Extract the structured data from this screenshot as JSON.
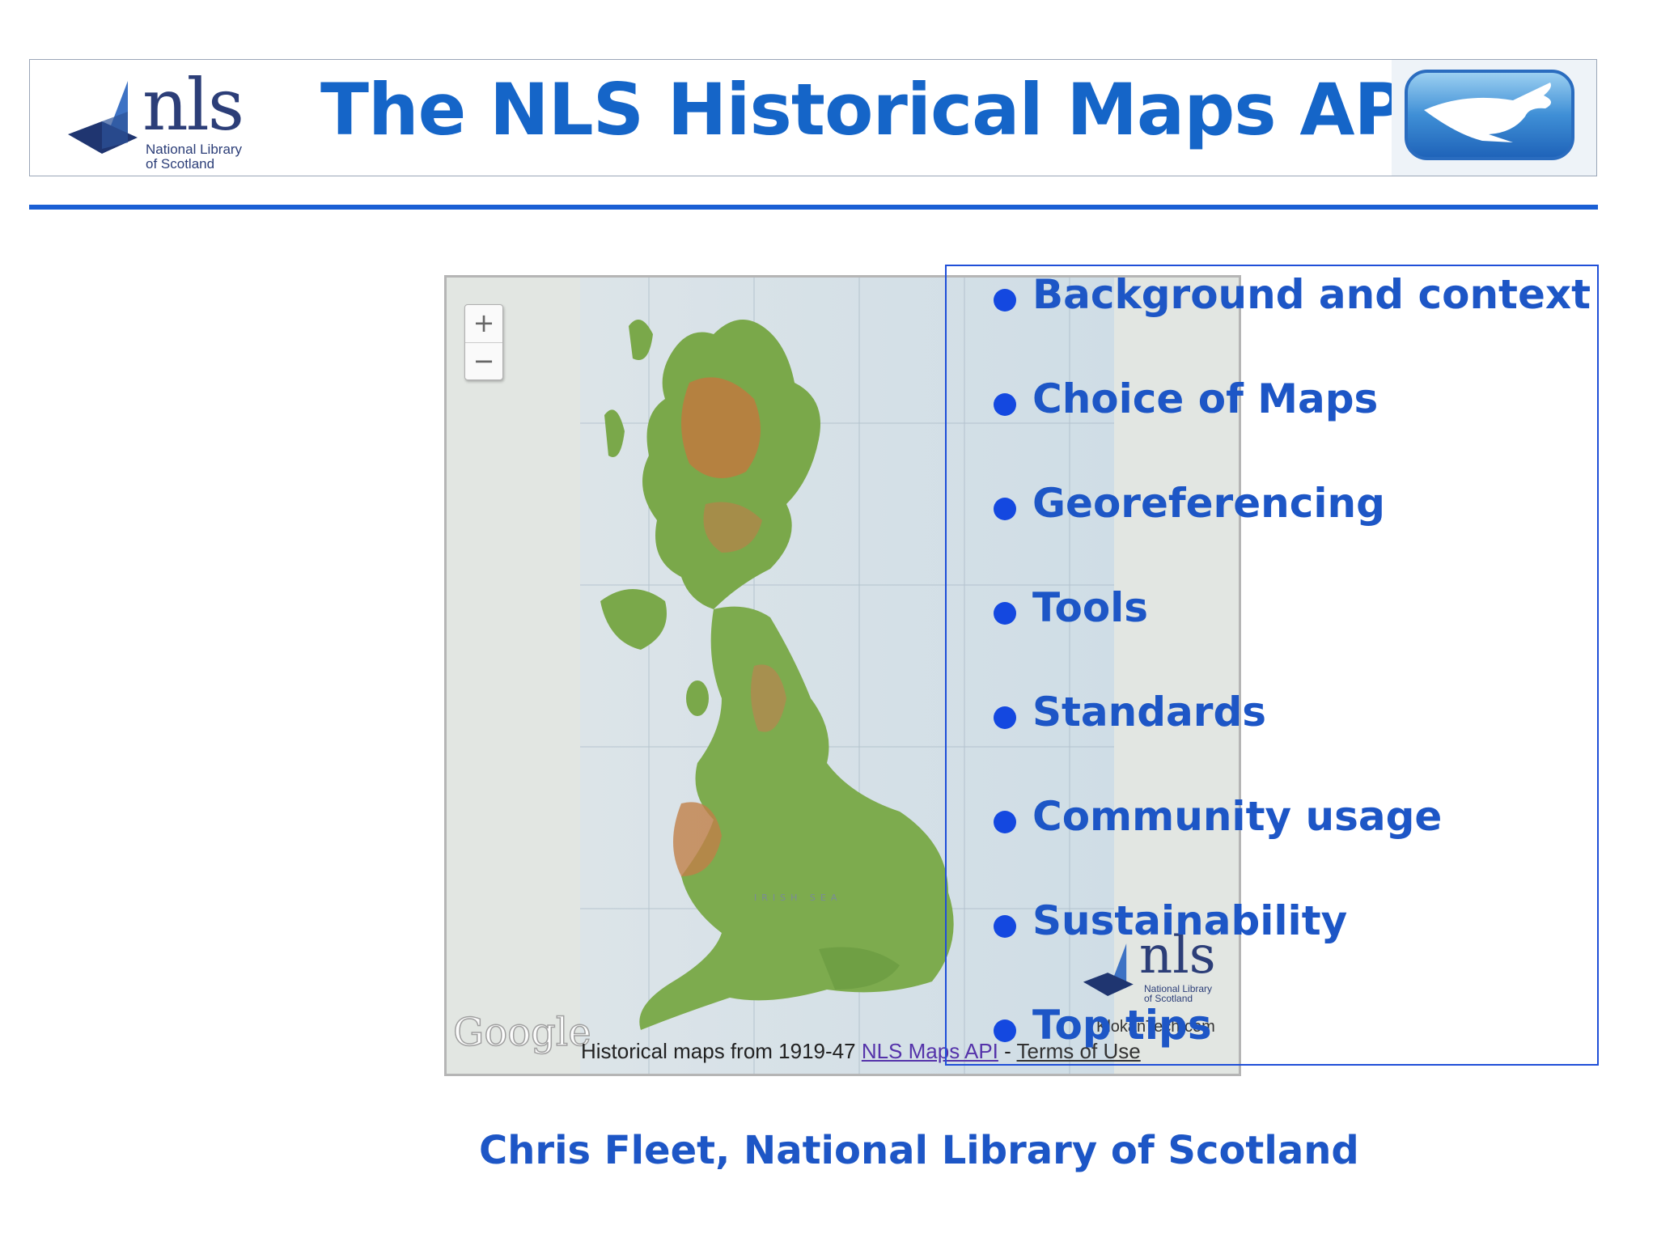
{
  "header": {
    "title": "The NLS Historical Maps API",
    "logo": {
      "word": "nls",
      "line1": "National Library",
      "line2": "of Scotland"
    },
    "partner_logo": "kangaroo-logo-icon"
  },
  "map": {
    "zoom_in": "+",
    "zoom_out": "−",
    "provider_logo": "Google",
    "attribution": {
      "prefix": "Historical maps from 1919-47",
      "link": "NLS Maps API",
      "separator": " - ",
      "terms": "Terms of Use"
    },
    "watermark": {
      "word": "nls",
      "line1": "National Library",
      "line2": "of Scotland"
    },
    "credit": "KlokanTech.com"
  },
  "bullets": [
    "Background and context",
    "Choice of Maps",
    "Georeferencing",
    "Tools",
    "Standards",
    "Community usage",
    "Sustainability",
    "Top tips"
  ],
  "footer": {
    "author": "Chris Fleet, National Library of Scotland"
  },
  "colors": {
    "title": "#1565c8",
    "rule": "#1a5fd4",
    "bullet": "#1448e0",
    "text": "#1d56c6"
  }
}
